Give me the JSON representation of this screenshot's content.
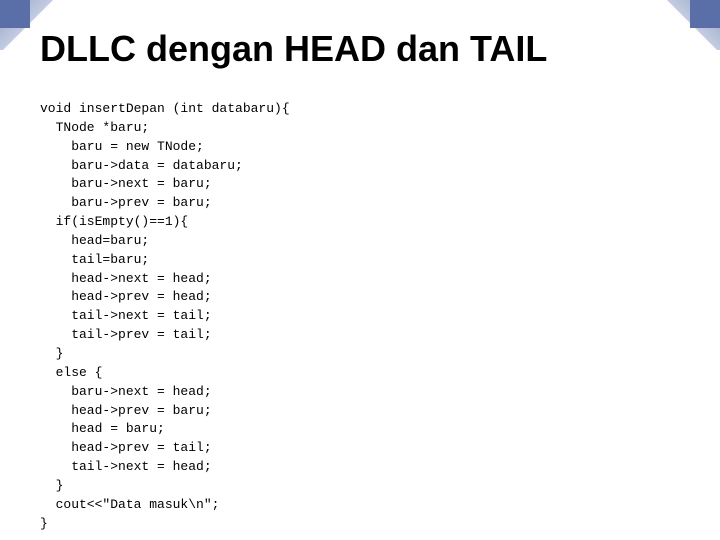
{
  "page": {
    "title": "DLLC dengan HEAD dan TAIL",
    "background_color": "#ffffff"
  },
  "code": {
    "lines": [
      "void insertDepan (int databaru){",
      "  TNode *baru;",
      "    baru = new TNode;",
      "    baru->data = databaru;",
      "    baru->next = baru;",
      "    baru->prev = baru;",
      "  if(isEmpty()==1){",
      "    head=baru;",
      "    tail=baru;",
      "    head->next = head;",
      "    head->prev = head;",
      "    tail->next = tail;",
      "    tail->prev = tail;",
      "  }",
      "  else {",
      "    baru->next = head;",
      "    head->prev = baru;",
      "    head = baru;",
      "    head->prev = tail;",
      "    tail->next = head;",
      "  }",
      "  cout<<\"Data masuk\\n\";",
      "}"
    ]
  }
}
